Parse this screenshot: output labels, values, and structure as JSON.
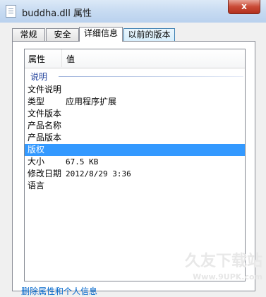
{
  "window": {
    "title": "buddha.dll 属性",
    "close_label": "x"
  },
  "tabs": [
    {
      "label": "常规"
    },
    {
      "label": "安全"
    },
    {
      "label": "详细信息"
    },
    {
      "label": "以前的版本"
    }
  ],
  "details": {
    "columns": {
      "property": "属性",
      "value": "值"
    },
    "group": "说明",
    "rows": [
      {
        "name": "文件说明",
        "value": ""
      },
      {
        "name": "类型",
        "value": "应用程序扩展"
      },
      {
        "name": "文件版本",
        "value": ""
      },
      {
        "name": "产品名称",
        "value": ""
      },
      {
        "name": "产品版本",
        "value": ""
      },
      {
        "name": "版权",
        "value": ""
      },
      {
        "name": "大小",
        "value": "67.5 KB"
      },
      {
        "name": "修改日期",
        "value": "2012/8/29 3:36"
      },
      {
        "name": "语言",
        "value": ""
      }
    ]
  },
  "bottom_link": "删除属性和个人信息",
  "watermark": {
    "text": "久友下载站",
    "sub": "Www.9UPK.com"
  },
  "colors": {
    "selection": "#3399ff",
    "group_label": "#1e3f9a",
    "close_button": "#c94a36"
  }
}
